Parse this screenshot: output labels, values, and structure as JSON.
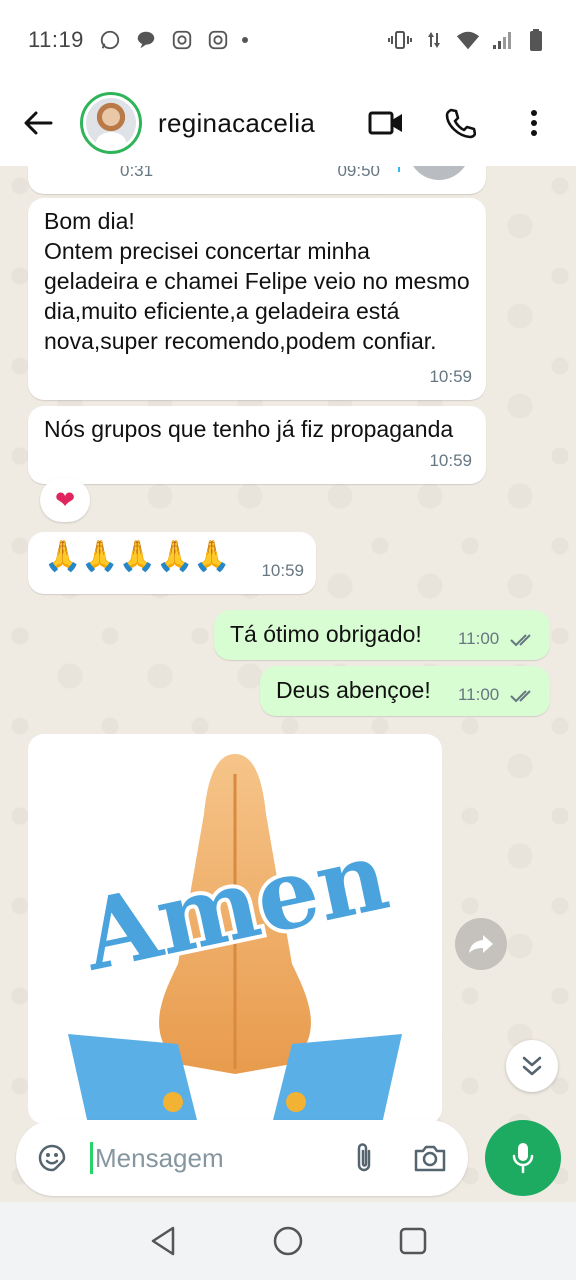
{
  "status_bar": {
    "time": "11:19",
    "left_icons": [
      "whatsapp-icon",
      "chat-bubble-icon",
      "instagram-icon",
      "instagram-icon",
      "dot-icon"
    ],
    "right_icons": [
      "vibrate-icon",
      "data-arrows-icon",
      "wifi-icon",
      "signal-icon",
      "battery-icon"
    ]
  },
  "header": {
    "contact_name": "reginacacelia",
    "actions": [
      "video-call-icon",
      "voice-call-icon",
      "more-vert-icon"
    ]
  },
  "messages": [
    {
      "type": "audio",
      "direction": "in",
      "duration": "0:31",
      "time": "09:50"
    },
    {
      "type": "text",
      "direction": "in",
      "text": "Bom dia!\nOntem precisei concertar minha geladeira e chamei Felipe veio no mesmo dia,muito eficiente,a geladeira está nova,super recomendo,podem confiar.",
      "time": "10:59"
    },
    {
      "type": "text",
      "direction": "in",
      "text": "Nós grupos que tenho já fiz propaganda",
      "time": "10:59",
      "reaction": "❤"
    },
    {
      "type": "text",
      "direction": "in",
      "text": "🙏🙏🙏🙏🙏",
      "time": "10:59"
    },
    {
      "type": "text",
      "direction": "out",
      "text": "Tá ótimo obrigado!",
      "time": "11:00",
      "status": "read"
    },
    {
      "type": "text",
      "direction": "out",
      "text": "Deus abençoe!",
      "time": "11:00",
      "status": "read"
    },
    {
      "type": "sticker",
      "direction": "in",
      "caption": "Amen"
    }
  ],
  "composer": {
    "placeholder": "Mensagem"
  },
  "colors": {
    "accent": "#1daa61",
    "chat_bg": "#efeae2",
    "outgoing_bubble": "#d9fdd3",
    "incoming_bubble": "#ffffff",
    "read_ticks": "#667781"
  }
}
